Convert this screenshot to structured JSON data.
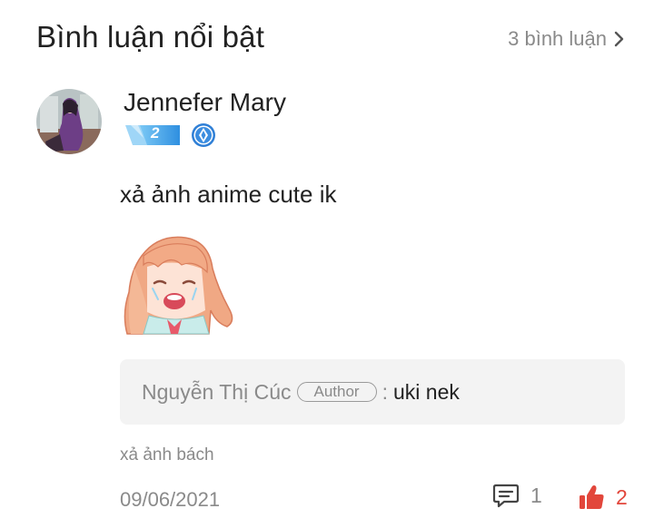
{
  "header": {
    "title": "Bình luận nổi bật",
    "comment_count_label": "3 bình luận",
    "chevron_icon": "chevron-right-icon"
  },
  "comment": {
    "author_name": "Jennefer Mary",
    "avatar_icon": "user-avatar",
    "level": "2",
    "level_badge_color": "#3aa0e8",
    "shield_badge_icon": "diamond-shield-icon",
    "text": "xả ảnh anime cute ik",
    "sticker_icon": "crying-anime-girl-sticker",
    "reply_preview": {
      "author": "Nguyễn Thị Cúc",
      "author_tag": "Author",
      "separator": ":",
      "text": "uki nek"
    },
    "sub_link": "xả ảnh bách",
    "date": "09/06/2021",
    "reply_count": "1",
    "like_count": "2",
    "like_color": "#e2463b"
  }
}
